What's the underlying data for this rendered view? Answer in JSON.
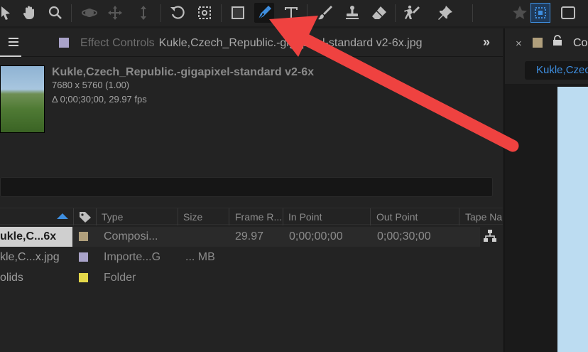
{
  "toolbar": {
    "tools": [
      {
        "name": "selection-tool",
        "icon": "arrow-icon"
      },
      {
        "name": "hand-tool",
        "icon": "hand-icon"
      },
      {
        "name": "zoom-tool",
        "icon": "magnifier-icon"
      },
      {
        "name": "orbit-camera-tool",
        "icon": "orbit-icon"
      },
      {
        "name": "pan-camera-tool",
        "icon": "move-icon"
      },
      {
        "name": "dolly-camera-tool",
        "icon": "dolly-icon"
      },
      {
        "name": "rotation-tool",
        "icon": "rotate-icon"
      },
      {
        "name": "pan-behind-tool",
        "icon": "anchor-icon"
      },
      {
        "name": "rectangle-tool",
        "icon": "rectangle-icon"
      },
      {
        "name": "pen-tool",
        "icon": "pen-icon",
        "active": true
      },
      {
        "name": "type-tool",
        "icon": "type-icon"
      },
      {
        "name": "brush-tool",
        "icon": "brush-icon"
      },
      {
        "name": "clone-stamp-tool",
        "icon": "stamp-icon"
      },
      {
        "name": "eraser-tool",
        "icon": "eraser-icon"
      },
      {
        "name": "roto-brush-tool",
        "icon": "roto-icon"
      },
      {
        "name": "puppet-pin-tool",
        "icon": "pin-icon"
      },
      {
        "name": "star-toggle",
        "icon": "star-icon"
      },
      {
        "name": "snapping-toggle",
        "icon": "snapping-icon"
      }
    ],
    "accent": "#3e8ee0"
  },
  "project_panel": {
    "tab_label": "Effect Controls",
    "tab_document": "Kukle,Czech_Republic.-gigapixel-standard v2-6x.jpg",
    "overflow": "»",
    "file": {
      "title": "Kukle,Czech_Republic.-gigapixel-standard v2-6x",
      "dimensions": "7680 x 5760 (1.00)",
      "duration": "Δ 0;00;30;00, 29.97 fps"
    },
    "columns": {
      "type": "Type",
      "size": "Size",
      "frame_rate": "Frame R...",
      "in_point": "In Point",
      "out_point": "Out Point",
      "tape_name": "Tape Na"
    },
    "rows": [
      {
        "name": "ukle,C...6x",
        "type": "Composi...",
        "size": "",
        "frame_rate": "29.97",
        "in_point": "0;00;00;00",
        "out_point": "0;00;30;00",
        "swatch": "#b09f7c"
      },
      {
        "name": "kle,C...x.jpg",
        "type": "Importe...G",
        "size": "... MB",
        "frame_rate": "",
        "in_point": "",
        "out_point": "",
        "swatch": "#a9a3c9"
      },
      {
        "name": "olids",
        "type": "Folder",
        "size": "",
        "frame_rate": "",
        "in_point": "",
        "out_point": "",
        "swatch": "#e4d84a"
      }
    ]
  },
  "comp_panel": {
    "close": "×",
    "title": "Co",
    "breadcrumb": "Kukle,Czec"
  }
}
